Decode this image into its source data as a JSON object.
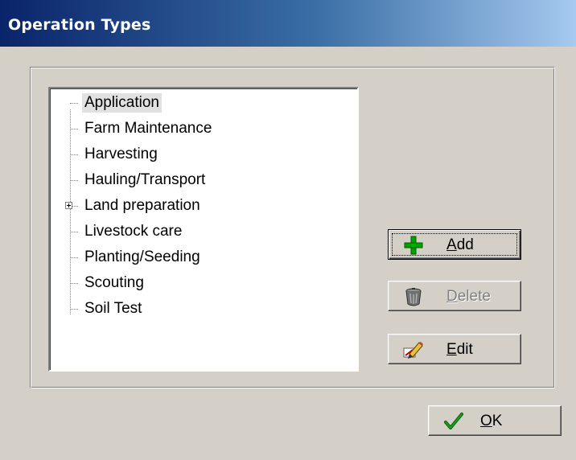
{
  "window": {
    "title": "Operation Types"
  },
  "tree": {
    "items": [
      {
        "label": "Application",
        "selected": true,
        "expandable": false
      },
      {
        "label": "Farm Maintenance",
        "selected": false,
        "expandable": false
      },
      {
        "label": "Harvesting",
        "selected": false,
        "expandable": false
      },
      {
        "label": "Hauling/Transport",
        "selected": false,
        "expandable": false
      },
      {
        "label": "Land preparation",
        "selected": false,
        "expandable": true
      },
      {
        "label": "Livestock care",
        "selected": false,
        "expandable": false
      },
      {
        "label": "Planting/Seeding",
        "selected": false,
        "expandable": false
      },
      {
        "label": "Scouting",
        "selected": false,
        "expandable": false
      },
      {
        "label": "Soil Test",
        "selected": false,
        "expandable": false
      }
    ]
  },
  "buttons": {
    "add": {
      "mnemonic": "A",
      "rest": "dd",
      "icon": "plus-icon",
      "enabled": true
    },
    "delete": {
      "mnemonic": "D",
      "rest": "elete",
      "icon": "trash-can-icon",
      "enabled": false
    },
    "edit": {
      "mnemonic": "E",
      "rest": "dit",
      "icon": "pencil-icon",
      "enabled": true
    },
    "ok": {
      "mnemonic": "O",
      "rest": "K",
      "icon": "checkmark-icon",
      "enabled": true
    }
  },
  "colors": {
    "title_gradient_start": "#0a246a",
    "title_gradient_end": "#a6caf0",
    "face": "#d4d0c8"
  }
}
